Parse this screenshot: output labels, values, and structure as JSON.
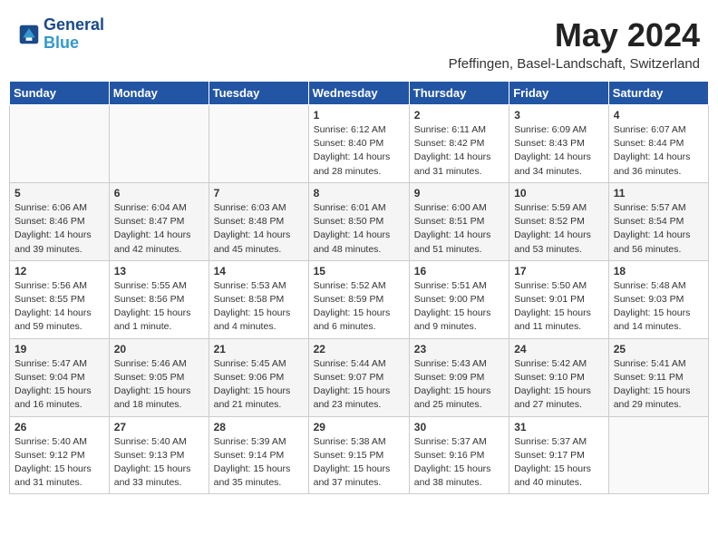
{
  "header": {
    "logo_line1": "General",
    "logo_line2": "Blue",
    "month_year": "May 2024",
    "location": "Pfeffingen, Basel-Landschaft, Switzerland"
  },
  "weekdays": [
    "Sunday",
    "Monday",
    "Tuesday",
    "Wednesday",
    "Thursday",
    "Friday",
    "Saturday"
  ],
  "weeks": [
    [
      {
        "day": "",
        "content": ""
      },
      {
        "day": "",
        "content": ""
      },
      {
        "day": "",
        "content": ""
      },
      {
        "day": "1",
        "content": "Sunrise: 6:12 AM\nSunset: 8:40 PM\nDaylight: 14 hours\nand 28 minutes."
      },
      {
        "day": "2",
        "content": "Sunrise: 6:11 AM\nSunset: 8:42 PM\nDaylight: 14 hours\nand 31 minutes."
      },
      {
        "day": "3",
        "content": "Sunrise: 6:09 AM\nSunset: 8:43 PM\nDaylight: 14 hours\nand 34 minutes."
      },
      {
        "day": "4",
        "content": "Sunrise: 6:07 AM\nSunset: 8:44 PM\nDaylight: 14 hours\nand 36 minutes."
      }
    ],
    [
      {
        "day": "5",
        "content": "Sunrise: 6:06 AM\nSunset: 8:46 PM\nDaylight: 14 hours\nand 39 minutes."
      },
      {
        "day": "6",
        "content": "Sunrise: 6:04 AM\nSunset: 8:47 PM\nDaylight: 14 hours\nand 42 minutes."
      },
      {
        "day": "7",
        "content": "Sunrise: 6:03 AM\nSunset: 8:48 PM\nDaylight: 14 hours\nand 45 minutes."
      },
      {
        "day": "8",
        "content": "Sunrise: 6:01 AM\nSunset: 8:50 PM\nDaylight: 14 hours\nand 48 minutes."
      },
      {
        "day": "9",
        "content": "Sunrise: 6:00 AM\nSunset: 8:51 PM\nDaylight: 14 hours\nand 51 minutes."
      },
      {
        "day": "10",
        "content": "Sunrise: 5:59 AM\nSunset: 8:52 PM\nDaylight: 14 hours\nand 53 minutes."
      },
      {
        "day": "11",
        "content": "Sunrise: 5:57 AM\nSunset: 8:54 PM\nDaylight: 14 hours\nand 56 minutes."
      }
    ],
    [
      {
        "day": "12",
        "content": "Sunrise: 5:56 AM\nSunset: 8:55 PM\nDaylight: 14 hours\nand 59 minutes."
      },
      {
        "day": "13",
        "content": "Sunrise: 5:55 AM\nSunset: 8:56 PM\nDaylight: 15 hours\nand 1 minute."
      },
      {
        "day": "14",
        "content": "Sunrise: 5:53 AM\nSunset: 8:58 PM\nDaylight: 15 hours\nand 4 minutes."
      },
      {
        "day": "15",
        "content": "Sunrise: 5:52 AM\nSunset: 8:59 PM\nDaylight: 15 hours\nand 6 minutes."
      },
      {
        "day": "16",
        "content": "Sunrise: 5:51 AM\nSunset: 9:00 PM\nDaylight: 15 hours\nand 9 minutes."
      },
      {
        "day": "17",
        "content": "Sunrise: 5:50 AM\nSunset: 9:01 PM\nDaylight: 15 hours\nand 11 minutes."
      },
      {
        "day": "18",
        "content": "Sunrise: 5:48 AM\nSunset: 9:03 PM\nDaylight: 15 hours\nand 14 minutes."
      }
    ],
    [
      {
        "day": "19",
        "content": "Sunrise: 5:47 AM\nSunset: 9:04 PM\nDaylight: 15 hours\nand 16 minutes."
      },
      {
        "day": "20",
        "content": "Sunrise: 5:46 AM\nSunset: 9:05 PM\nDaylight: 15 hours\nand 18 minutes."
      },
      {
        "day": "21",
        "content": "Sunrise: 5:45 AM\nSunset: 9:06 PM\nDaylight: 15 hours\nand 21 minutes."
      },
      {
        "day": "22",
        "content": "Sunrise: 5:44 AM\nSunset: 9:07 PM\nDaylight: 15 hours\nand 23 minutes."
      },
      {
        "day": "23",
        "content": "Sunrise: 5:43 AM\nSunset: 9:09 PM\nDaylight: 15 hours\nand 25 minutes."
      },
      {
        "day": "24",
        "content": "Sunrise: 5:42 AM\nSunset: 9:10 PM\nDaylight: 15 hours\nand 27 minutes."
      },
      {
        "day": "25",
        "content": "Sunrise: 5:41 AM\nSunset: 9:11 PM\nDaylight: 15 hours\nand 29 minutes."
      }
    ],
    [
      {
        "day": "26",
        "content": "Sunrise: 5:40 AM\nSunset: 9:12 PM\nDaylight: 15 hours\nand 31 minutes."
      },
      {
        "day": "27",
        "content": "Sunrise: 5:40 AM\nSunset: 9:13 PM\nDaylight: 15 hours\nand 33 minutes."
      },
      {
        "day": "28",
        "content": "Sunrise: 5:39 AM\nSunset: 9:14 PM\nDaylight: 15 hours\nand 35 minutes."
      },
      {
        "day": "29",
        "content": "Sunrise: 5:38 AM\nSunset: 9:15 PM\nDaylight: 15 hours\nand 37 minutes."
      },
      {
        "day": "30",
        "content": "Sunrise: 5:37 AM\nSunset: 9:16 PM\nDaylight: 15 hours\nand 38 minutes."
      },
      {
        "day": "31",
        "content": "Sunrise: 5:37 AM\nSunset: 9:17 PM\nDaylight: 15 hours\nand 40 minutes."
      },
      {
        "day": "",
        "content": ""
      }
    ]
  ]
}
